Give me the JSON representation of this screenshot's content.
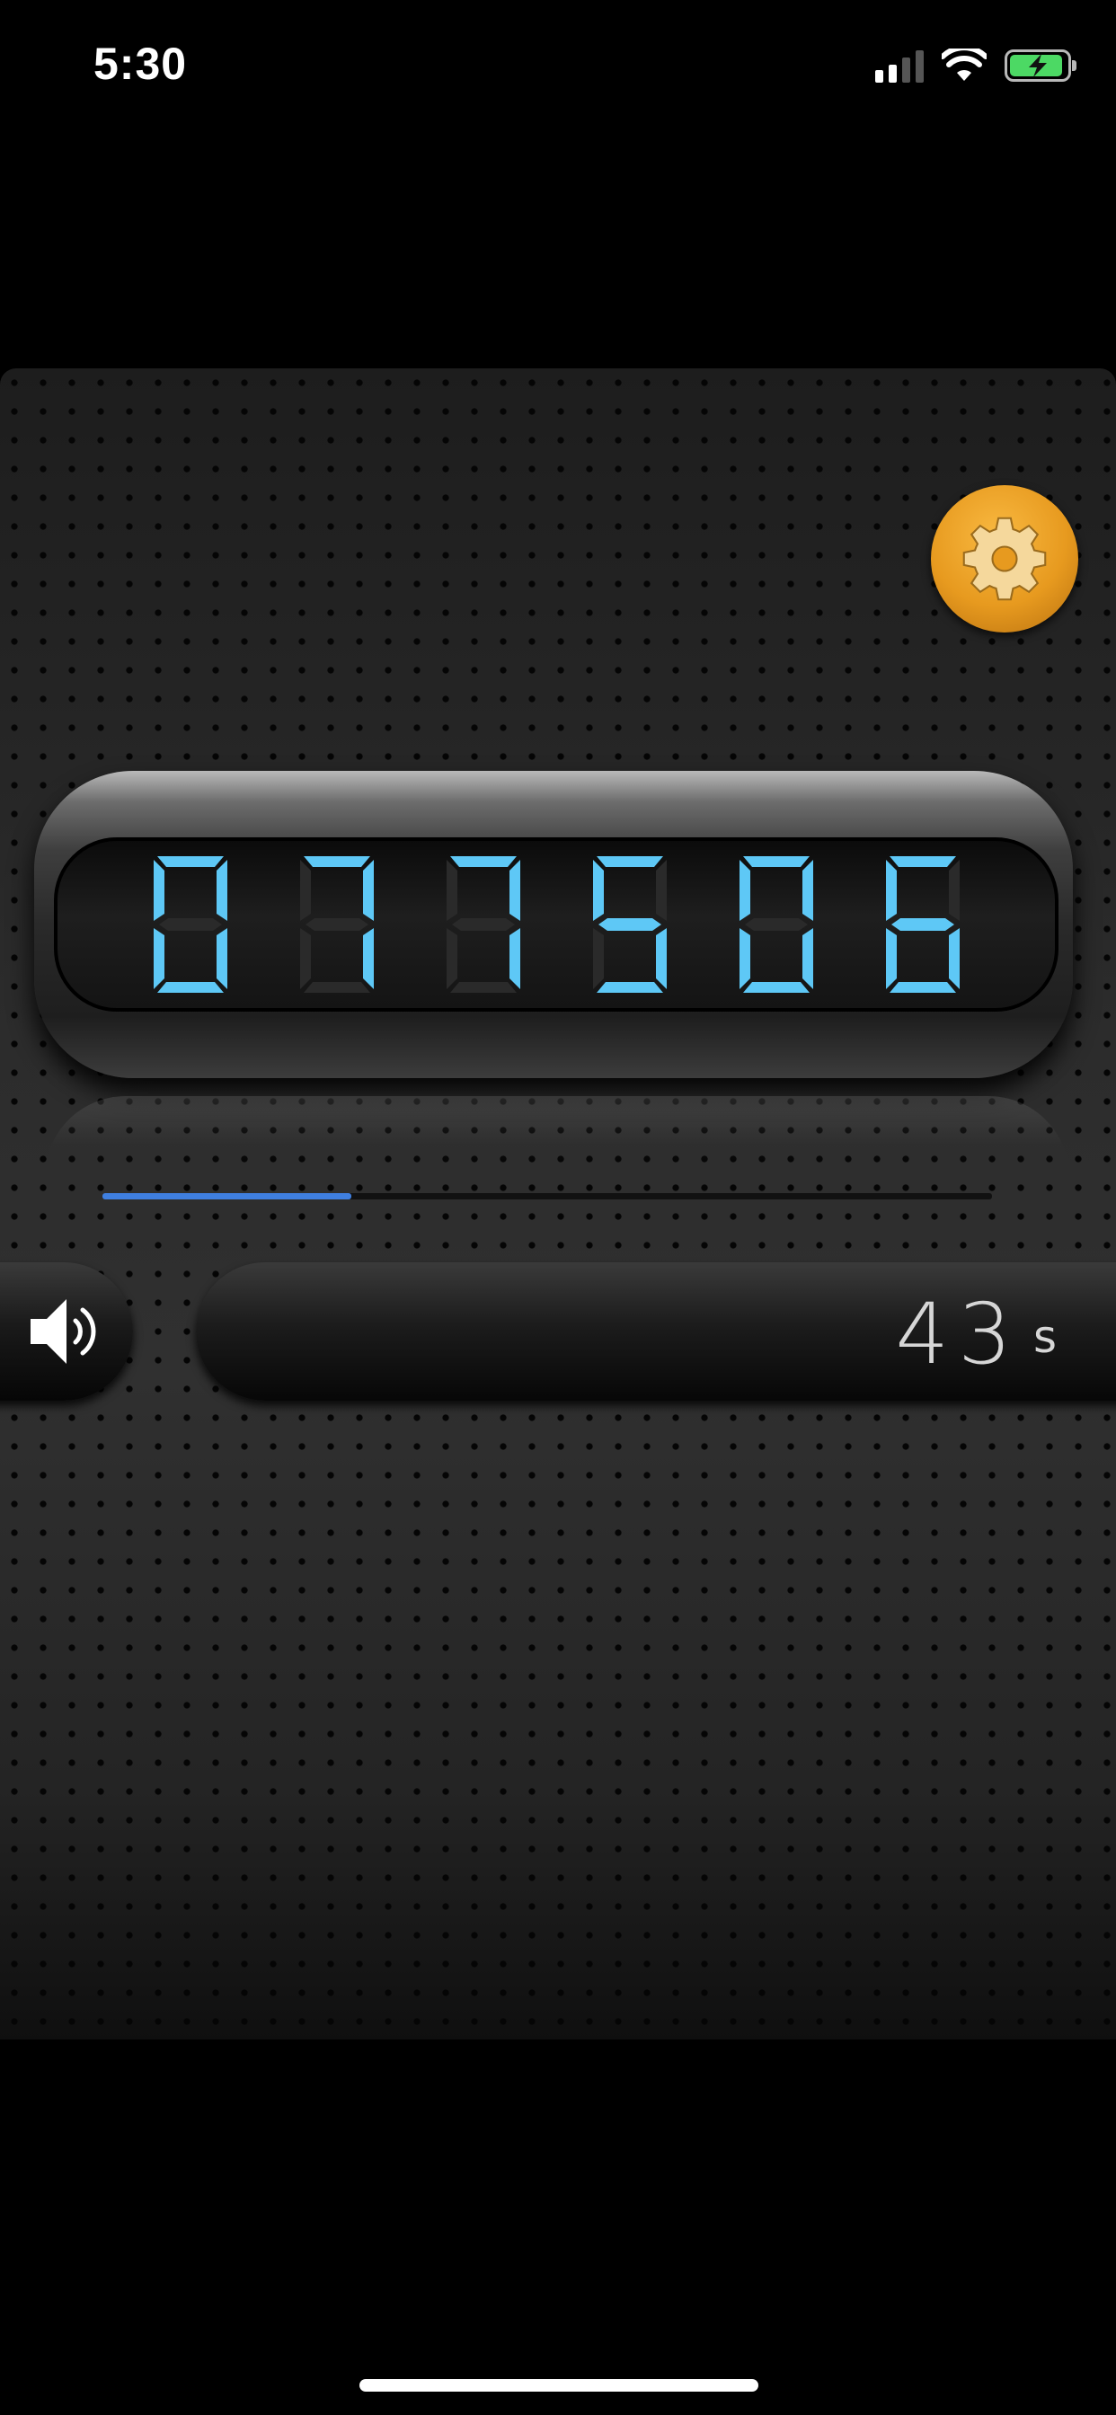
{
  "status_bar": {
    "time": "5:30",
    "icons": [
      "cellular-signal-icon",
      "wifi-icon",
      "battery-charging-icon"
    ],
    "battery_color": "#4cd964"
  },
  "settings": {
    "icon": "gear-icon",
    "color": "#e79a1f"
  },
  "counter": {
    "digits": [
      "0",
      "7",
      "7",
      "5",
      "0",
      "6"
    ],
    "color": "#5ec8f6"
  },
  "progress": {
    "value": 0.28,
    "color": "#3f7fe0"
  },
  "sound": {
    "icon": "speaker-icon"
  },
  "timer": {
    "value": "43",
    "unit": "s"
  }
}
